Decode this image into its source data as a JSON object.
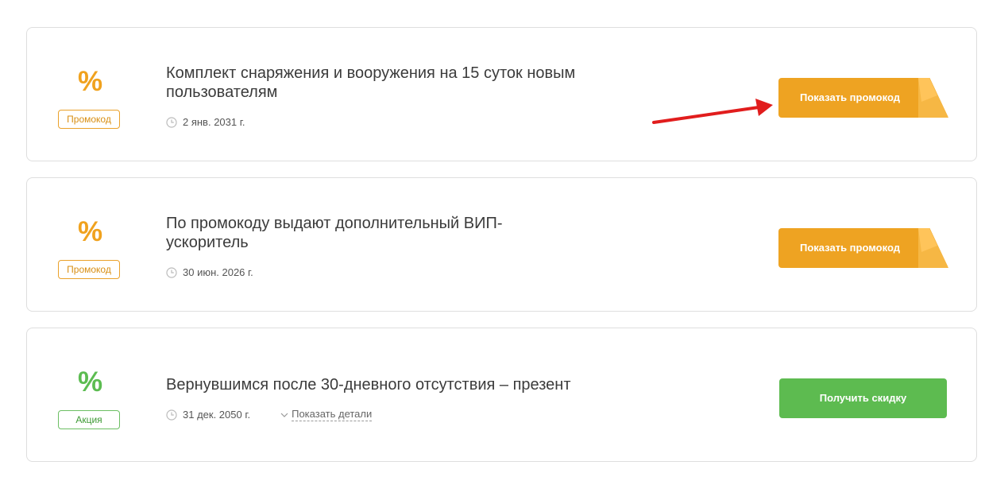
{
  "colors": {
    "promo_accent": "#eea322",
    "deal_accent": "#5dbb50",
    "card_border": "#dedede",
    "title_text": "#3b3b3b",
    "annotation_arrow": "#e11d1d"
  },
  "offers": [
    {
      "icon": "percent-icon",
      "symbol": "%",
      "badge": "Промокод",
      "title": "Комплект снаряжения и вооружения на 15 суток новым пользователям",
      "date": "2 янв. 2031 г.",
      "button_label": "Показать промокод"
    },
    {
      "icon": "percent-icon",
      "symbol": "%",
      "badge": "Промокод",
      "title": "По промокоду выдают дополнительный ВИП-ускоритель",
      "date": "30 июн. 2026 г.",
      "button_label": "Показать промокод"
    },
    {
      "icon": "percent-icon",
      "symbol": "%",
      "badge": "Акция",
      "title": "Вернувшимся после 30-дневного отсутствия – презент",
      "date": "31 дек. 2050 г.",
      "details_label": "Показать детали",
      "button_label": "Получить скидку"
    }
  ]
}
